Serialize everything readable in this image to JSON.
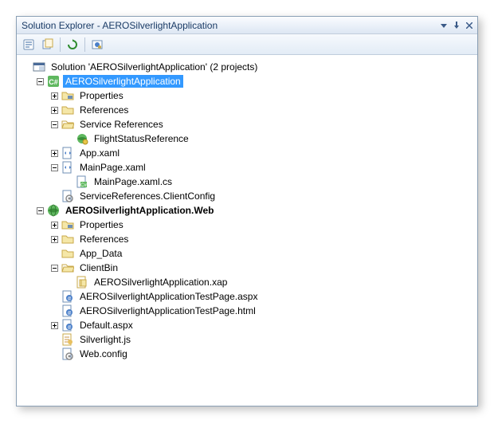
{
  "titlebar": {
    "text": "Solution Explorer - AEROSilverlightApplication"
  },
  "tree": {
    "solution": "Solution 'AEROSilverlightApplication' (2 projects)",
    "p1": {
      "name": "AEROSilverlightApplication",
      "properties": "Properties",
      "references": "References",
      "service_refs": "Service References",
      "flight_status": "FlightStatusReference",
      "app_xaml": "App.xaml",
      "mainpage": "MainPage.xaml",
      "mainpage_cs": "MainPage.xaml.cs",
      "svc_config": "ServiceReferences.ClientConfig"
    },
    "p2": {
      "name": "AEROSilverlightApplication.Web",
      "properties": "Properties",
      "references": "References",
      "app_data": "App_Data",
      "clientbin": "ClientBin",
      "xap": "AEROSilverlightApplication.xap",
      "test_aspx": "AEROSilverlightApplicationTestPage.aspx",
      "test_html": "AEROSilverlightApplicationTestPage.html",
      "default_aspx": "Default.aspx",
      "silverlight_js": "Silverlight.js",
      "web_config": "Web.config"
    }
  }
}
